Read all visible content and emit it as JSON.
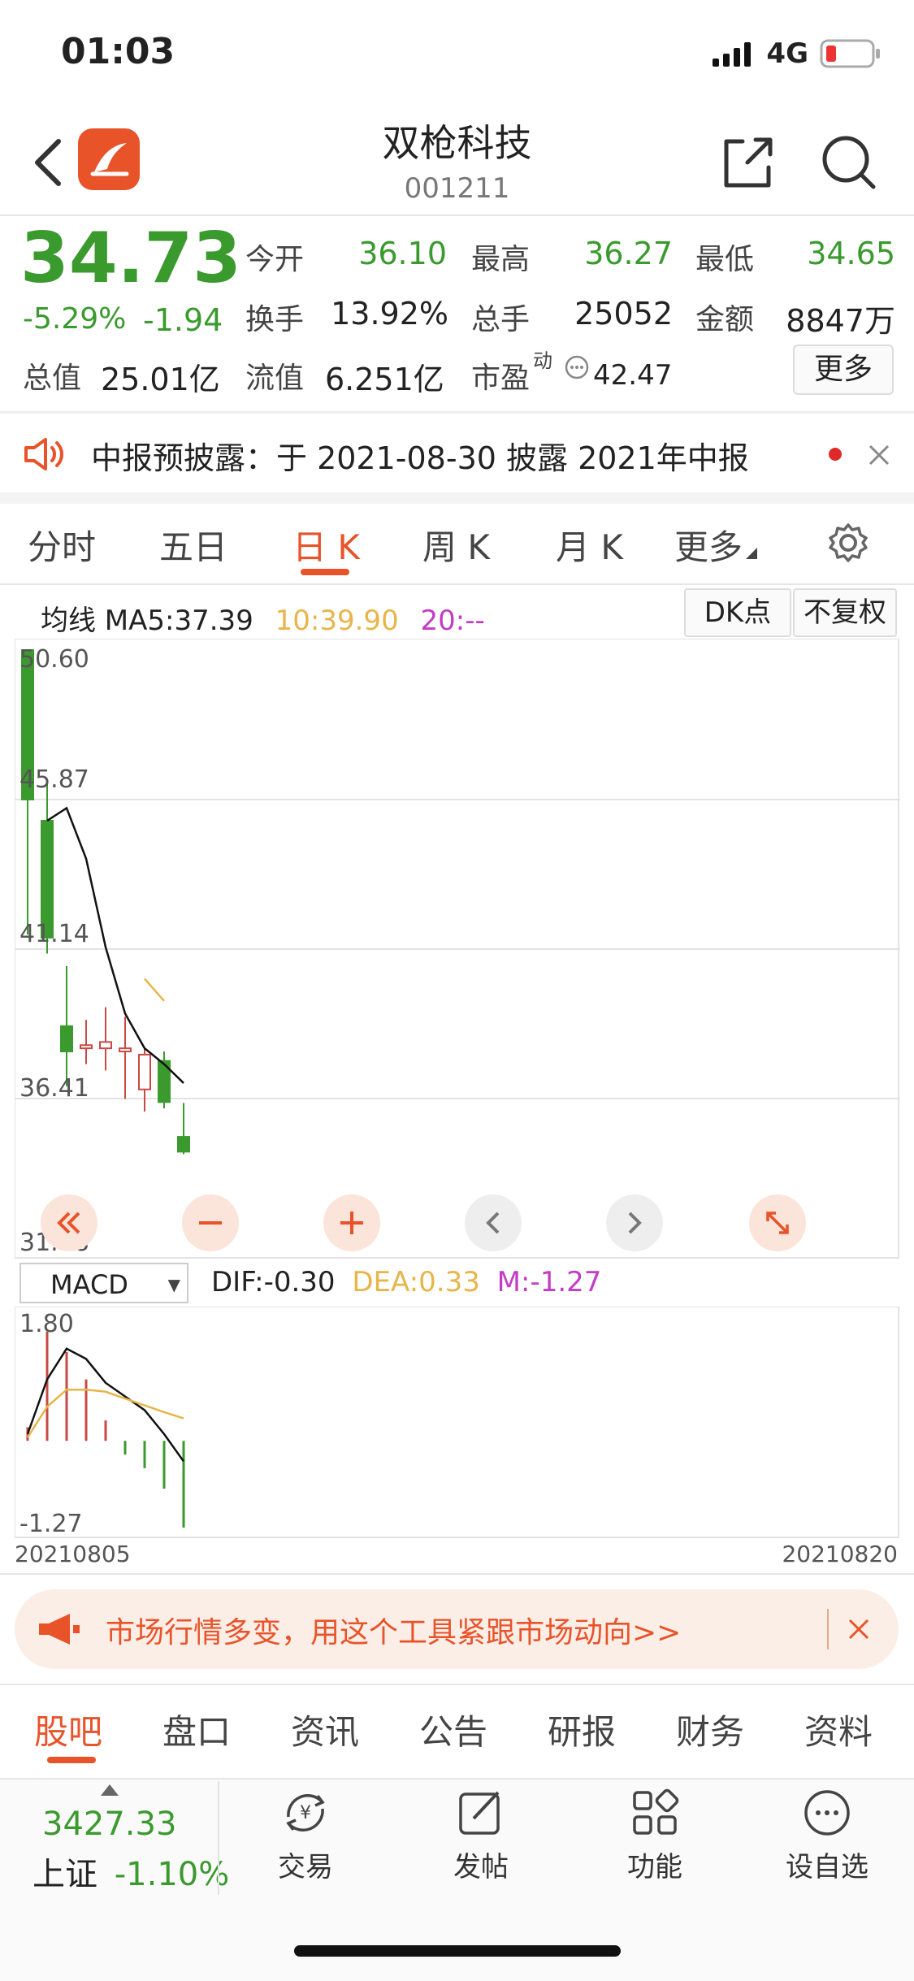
{
  "status": {
    "time": "01:03",
    "network": "4G"
  },
  "header": {
    "title": "双枪科技",
    "code": "001211"
  },
  "quote": {
    "price": "34.73",
    "change_pct": "-5.29%",
    "change": "-1.94",
    "open_label": "今开",
    "open": "36.10",
    "high_label": "最高",
    "high": "36.27",
    "low_label": "最低",
    "low": "34.65",
    "turnover_label": "换手",
    "turnover": "13.92%",
    "volume_label": "总手",
    "volume": "25052",
    "amount_label": "金额",
    "amount": "8847万",
    "mktcap_label": "总值",
    "mktcap": "25.01亿",
    "float_label": "流值",
    "float": "6.251亿",
    "pe_label": "市盈",
    "pe_sup": "动",
    "pe": "42.47",
    "more_label": "更多"
  },
  "notice": {
    "text": "中报预披露：于 2021-08-30 披露 2021年中报"
  },
  "chart_tabs": [
    "分时",
    "五日",
    "日 K",
    "周 K",
    "月 K",
    "更多"
  ],
  "ma_bar": {
    "label": "均线 MA5:37.39",
    "ma10": "10:39.90",
    "ma20": "20:--",
    "dk_label": "DK点",
    "adj_label": "不复权"
  },
  "chart_data": [
    {
      "type": "candlestick",
      "ylim": [
        31.68,
        50.6
      ],
      "y_ticks": [
        "50.60",
        "45.87",
        "41.14",
        "36.41",
        "31.68"
      ],
      "x_start": "20210805",
      "x_end": "20210820",
      "candles": [
        {
          "open": 50.6,
          "close": 45.87,
          "high": 50.6,
          "low": 41.6
        },
        {
          "open": 45.2,
          "close": 41.5,
          "high": 46.4,
          "low": 41.0
        },
        {
          "open": 38.7,
          "close": 37.9,
          "high": 40.6,
          "low": 36.8
        },
        {
          "open": 38.0,
          "close": 38.1,
          "high": 38.9,
          "low": 37.5
        },
        {
          "open": 38.0,
          "close": 38.2,
          "high": 39.3,
          "low": 37.3
        },
        {
          "open": 37.9,
          "close": 38.0,
          "high": 39.0,
          "low": 36.4
        },
        {
          "open": 36.7,
          "close": 37.8,
          "high": 38.0,
          "low": 36.0
        },
        {
          "open": 37.6,
          "close": 36.3,
          "high": 37.9,
          "low": 36.1
        },
        {
          "open": 35.2,
          "close": 34.73,
          "high": 36.27,
          "low": 34.65
        }
      ],
      "ma5": [
        null,
        45.2,
        45.6,
        44.0,
        41.2,
        39.1,
        38.0,
        37.5,
        36.9
      ],
      "ma10": [
        null,
        null,
        null,
        null,
        null,
        null,
        40.2,
        39.5,
        null
      ]
    },
    {
      "type": "bar",
      "name": "MACD",
      "ylim": [
        -1.27,
        1.8
      ],
      "y_ticks": [
        "1.80",
        "-1.27"
      ],
      "dif_label": "DIF:-0.30",
      "dea_label": "DEA:0.33",
      "m_label": "M:-1.27",
      "hist": [
        0.2,
        1.6,
        1.3,
        0.9,
        0.3,
        -0.2,
        -0.4,
        -0.7,
        -1.27
      ],
      "dif": [
        0.1,
        0.9,
        1.35,
        1.2,
        0.85,
        0.65,
        0.45,
        0.1,
        -0.3
      ],
      "dea": [
        0.05,
        0.5,
        0.75,
        0.75,
        0.72,
        0.62,
        0.52,
        0.42,
        0.33
      ]
    }
  ],
  "banner": {
    "text": "市场行情多变，用这个工具紧跟市场动向>>"
  },
  "bottom_tabs": [
    "股吧",
    "盘口",
    "资讯",
    "公告",
    "研报",
    "财务",
    "资料"
  ],
  "toolbar": {
    "index_value": "3427.33",
    "index_name": "上证",
    "index_change": "-1.10%",
    "trade": "交易",
    "post": "发帖",
    "func": "功能",
    "watch": "设自选"
  },
  "colors": {
    "up": "#c94a45",
    "down": "#3a9a2e",
    "accent": "#e8532a",
    "ma10": "#e7b54a",
    "ma20": "#c33bc6"
  }
}
